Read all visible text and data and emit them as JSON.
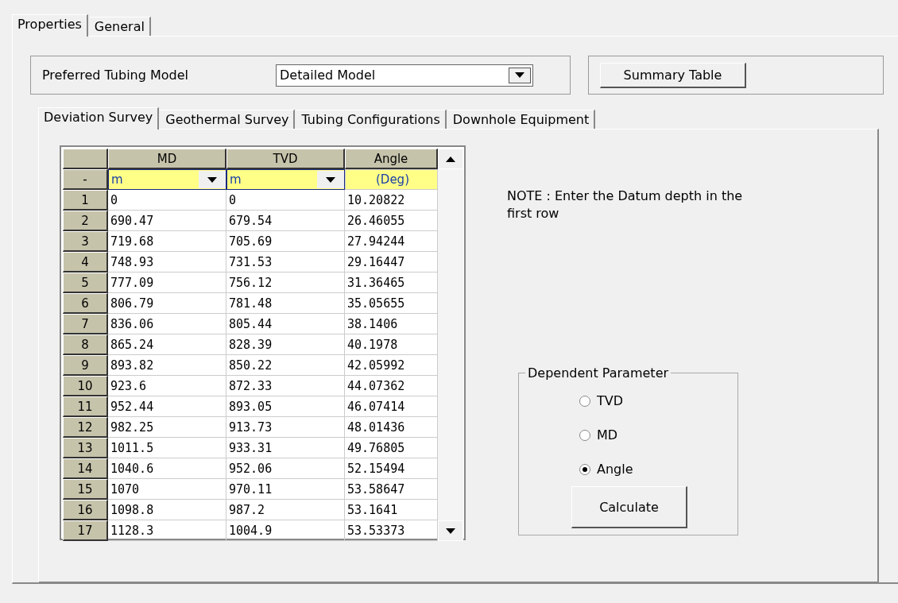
{
  "tabs": [
    {
      "label": "Properties",
      "selected": true
    },
    {
      "label": "General",
      "selected": false
    }
  ],
  "tubing_model": {
    "label": "Preferred Tubing Model",
    "value": "Detailed Model"
  },
  "summary_button": "Summary Table",
  "sub_tabs": [
    {
      "label": "Deviation Survey",
      "selected": true
    },
    {
      "label": "Geothermal Survey",
      "selected": false
    },
    {
      "label": "Tubing Configurations",
      "selected": false
    },
    {
      "label": "Downhole Equipment",
      "selected": false
    }
  ],
  "table": {
    "units_row_label": "-",
    "columns": [
      {
        "label": "MD",
        "unit": "m",
        "kind": "dropdown"
      },
      {
        "label": "TVD",
        "unit": "m",
        "kind": "dropdown"
      },
      {
        "label": "Angle",
        "unit": "(Deg)",
        "kind": "text"
      }
    ],
    "rows": [
      {
        "n": "1",
        "cells": [
          "0",
          "0",
          "10.20822"
        ]
      },
      {
        "n": "2",
        "cells": [
          "690.47",
          "679.54",
          "26.46055"
        ]
      },
      {
        "n": "3",
        "cells": [
          "719.68",
          "705.69",
          "27.94244"
        ]
      },
      {
        "n": "4",
        "cells": [
          "748.93",
          "731.53",
          "29.16447"
        ]
      },
      {
        "n": "5",
        "cells": [
          "777.09",
          "756.12",
          "31.36465"
        ]
      },
      {
        "n": "6",
        "cells": [
          "806.79",
          "781.48",
          "35.05655"
        ]
      },
      {
        "n": "7",
        "cells": [
          "836.06",
          "805.44",
          "38.1406"
        ]
      },
      {
        "n": "8",
        "cells": [
          "865.24",
          "828.39",
          "40.1978"
        ]
      },
      {
        "n": "9",
        "cells": [
          "893.82",
          "850.22",
          "42.05992"
        ]
      },
      {
        "n": "10",
        "cells": [
          "923.6",
          "872.33",
          "44.07362"
        ]
      },
      {
        "n": "11",
        "cells": [
          "952.44",
          "893.05",
          "46.07414"
        ]
      },
      {
        "n": "12",
        "cells": [
          "982.25",
          "913.73",
          "48.01436"
        ]
      },
      {
        "n": "13",
        "cells": [
          "1011.5",
          "933.31",
          "49.76805"
        ]
      },
      {
        "n": "14",
        "cells": [
          "1040.6",
          "952.06",
          "52.15494"
        ]
      },
      {
        "n": "15",
        "cells": [
          "1070",
          "970.11",
          "53.58647"
        ]
      },
      {
        "n": "16",
        "cells": [
          "1098.8",
          "987.2",
          "53.1641"
        ]
      },
      {
        "n": "17",
        "cells": [
          "1128.3",
          "1004.9",
          "53.53373"
        ]
      }
    ]
  },
  "note": "NOTE : Enter the Datum depth in the first row",
  "dependent_parameter": {
    "title": "Dependent Parameter",
    "options": [
      {
        "label": "TVD",
        "selected": false
      },
      {
        "label": "MD",
        "selected": false
      },
      {
        "label": "Angle",
        "selected": true
      }
    ],
    "button": "Calculate"
  }
}
